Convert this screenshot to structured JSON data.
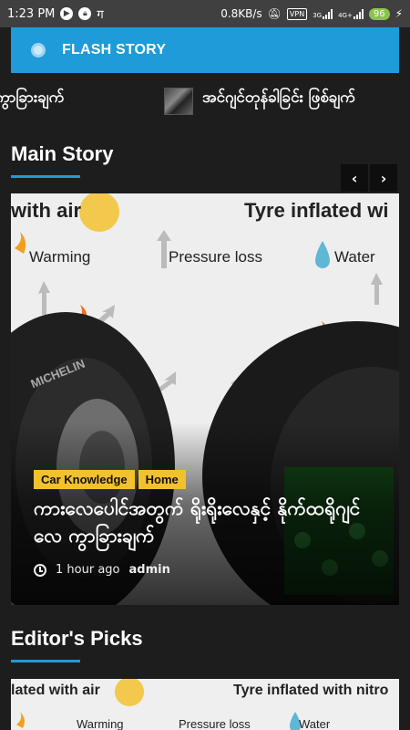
{
  "status_bar": {
    "time": "1:23 PM",
    "net_speed": "0.8KB/s",
    "vpn": "VPN",
    "net1": "3G",
    "net2": "4G+",
    "battery": "96",
    "app_icon_glyph": "ग"
  },
  "header": {
    "title": "FLASH STORY"
  },
  "ticker": {
    "items": [
      "ကွာခြားချက်",
      "အင်ဂျင်တုန်ခါခြင်း ဖြစ်ချက်"
    ]
  },
  "main_story": {
    "section_title": "Main Story",
    "prev_label": "‹",
    "next_label": "›",
    "image_text": {
      "left_heading": "with air",
      "right_heading": "Tyre inflated wi",
      "warming": "Warming",
      "pressure_loss": "Pressure loss",
      "water": "Water",
      "brand": "MICHELIN"
    },
    "categories": [
      "Car Knowledge",
      "Home"
    ],
    "title": "ကားလေပေါင်အတွက် ရိုးရိုးလေနှင့် နိုက်ထရိုဂျင်လေ ကွာခြားချက်",
    "time_ago": "1 hour ago",
    "author": "admin"
  },
  "editors_picks": {
    "section_title": "Editor's Picks",
    "image_text": {
      "left_heading": "lated with air",
      "right_heading": "Tyre inflated with nitro",
      "warming": "Warming",
      "pressure_loss": "Pressure loss",
      "water": "Water"
    }
  },
  "colors": {
    "accent": "#1e9bd8",
    "badge": "#f2c12e",
    "background": "#1d1d1d"
  }
}
